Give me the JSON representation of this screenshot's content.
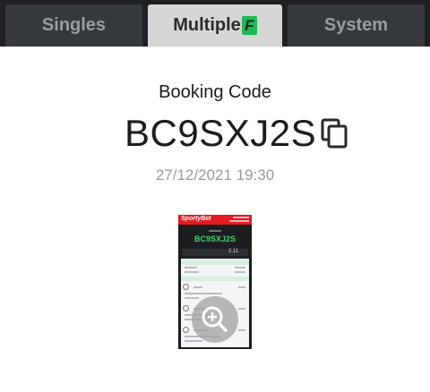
{
  "tabs": [
    {
      "label": "Singles",
      "active": false
    },
    {
      "label": "Multiple",
      "badge": "F",
      "active": true
    },
    {
      "label": "System",
      "active": false
    }
  ],
  "booking": {
    "label": "Booking Code",
    "code": "BC9SXJ2S",
    "timestamp": "27/12/2021 19:30"
  },
  "thumbnail": {
    "brand": "SportyBet",
    "code": "BC9SXJ2S",
    "odds": "2.11"
  },
  "icons": {
    "copy": "copy-icon",
    "zoom": "zoom-in-icon"
  },
  "colors": {
    "tabbar_bg": "#1e2024",
    "tab_active_bg": "#d6d6d6",
    "badge_green": "#1db954",
    "brand_red": "#e31b23",
    "code_green": "#3ed36b"
  }
}
